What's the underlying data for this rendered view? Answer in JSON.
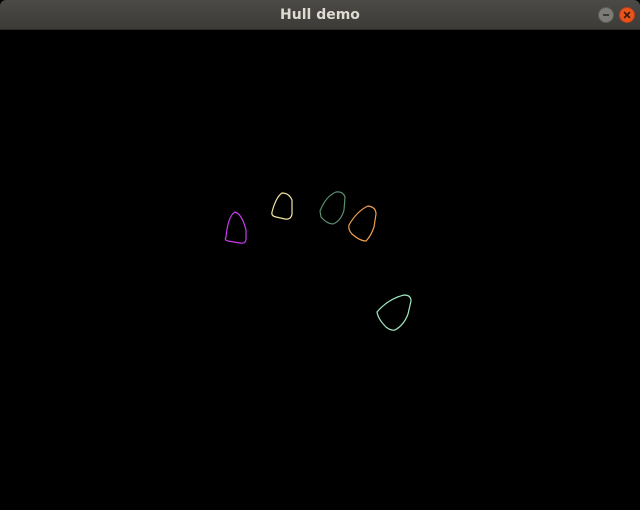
{
  "window": {
    "title": "Hull demo",
    "minimize_icon": "minimize-icon",
    "close_icon": "close-icon"
  },
  "canvas": {
    "background": "#000000",
    "hulls": [
      {
        "name": "magenta",
        "color": "#c83cf0"
      },
      {
        "name": "yellow",
        "color": "#f0e6a0"
      },
      {
        "name": "dark-green",
        "color": "#5a9070"
      },
      {
        "name": "orange",
        "color": "#f0a050"
      },
      {
        "name": "mint",
        "color": "#a0e8c0"
      }
    ]
  }
}
